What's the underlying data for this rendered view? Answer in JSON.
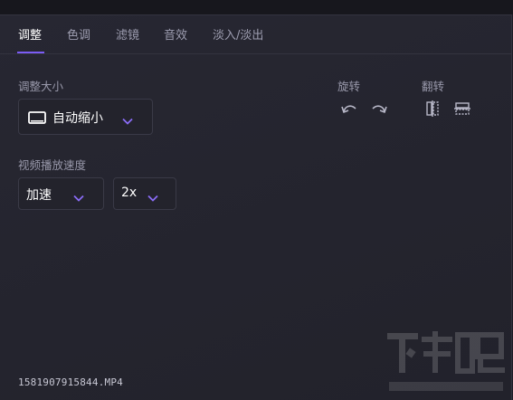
{
  "tabs": [
    {
      "label": "调整",
      "active": true
    },
    {
      "label": "色调",
      "active": false
    },
    {
      "label": "滤镜",
      "active": false
    },
    {
      "label": "音效",
      "active": false
    },
    {
      "label": "淡入/淡出",
      "active": false
    }
  ],
  "resize": {
    "label": "调整大小",
    "value": "自动缩小",
    "icon": "monitor-icon"
  },
  "rotate": {
    "label": "旋转",
    "icons": [
      "rotate-left-icon",
      "rotate-right-icon"
    ]
  },
  "flip": {
    "label": "翻转",
    "icons": [
      "flip-horizontal-icon",
      "flip-vertical-icon"
    ]
  },
  "speed": {
    "label": "视频播放速度",
    "mode": "加速",
    "rate": "2x"
  },
  "file": {
    "name": "1581907915844.MP4"
  },
  "colors": {
    "accent": "#7b5cf5",
    "background": "#25252f",
    "text_primary": "#ffffff",
    "text_muted": "#9898aa"
  }
}
